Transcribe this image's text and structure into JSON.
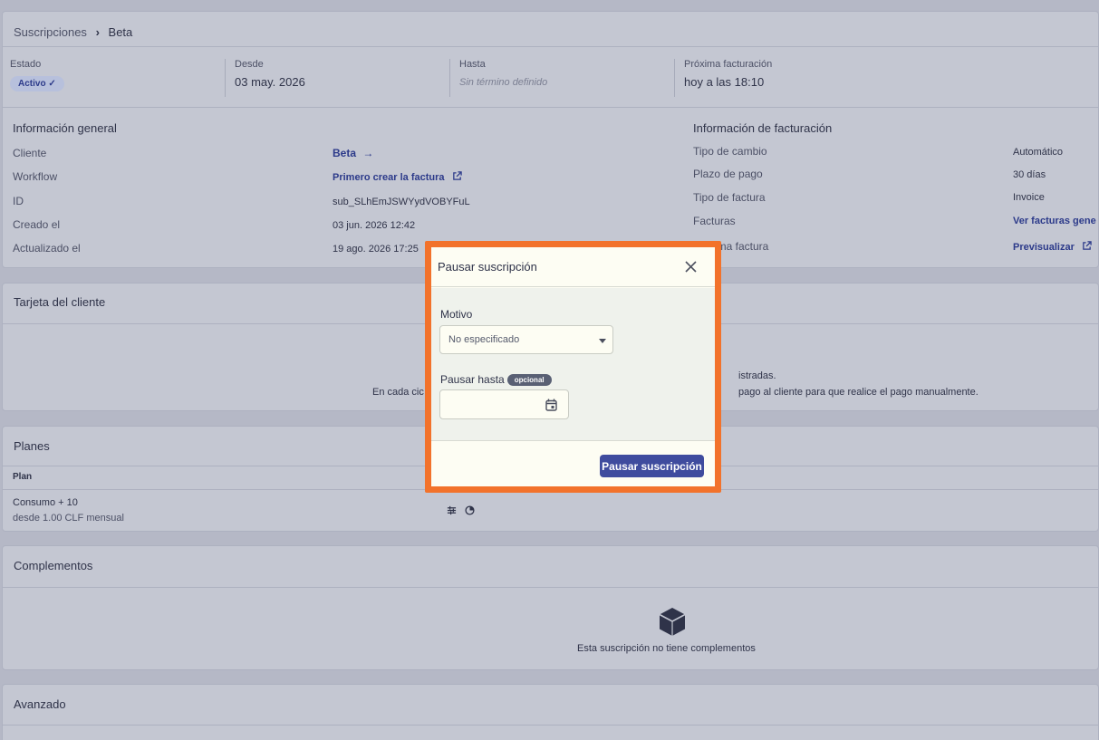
{
  "breadcrumb": {
    "root": "Suscripciones",
    "separator": "›",
    "current": "Beta"
  },
  "stats": {
    "estado": {
      "label": "Estado",
      "value": "Activo ✓"
    },
    "desde": {
      "label": "Desde",
      "value": "03 may. 2026"
    },
    "hasta": {
      "label": "Hasta",
      "value": "Sin término definido"
    },
    "proxima": {
      "label": "Próxima facturación",
      "value": "hoy a las 18:10"
    }
  },
  "general": {
    "title": "Información general",
    "rows": [
      {
        "label": "Cliente",
        "value": "Beta"
      },
      {
        "label": "Workflow",
        "value": "Primero crear la factura"
      },
      {
        "label": "ID",
        "value": "sub_SLhEmJSWYydVOBYFuL"
      },
      {
        "label": "Creado el",
        "value": "03 jun. 2026 12:42"
      },
      {
        "label": "Actualizado el",
        "value": "19 ago. 2026 17:25"
      }
    ]
  },
  "billing": {
    "title": "Información de facturación",
    "rows": [
      {
        "label": "Tipo de cambio",
        "value": "Automático"
      },
      {
        "label": "Plazo de pago",
        "value": "30 días"
      },
      {
        "label": "Tipo de factura",
        "value": "Invoice"
      },
      {
        "label": "Facturas",
        "value": "Ver facturas gene"
      },
      {
        "label": "xima factura",
        "value": "Previsualizar"
      }
    ]
  },
  "tarjeta": {
    "title": "Tarjeta del cliente",
    "line1_right": "istradas.",
    "line2_left": "En cada cic",
    "line2_right": "pago al cliente para que realice el pago manualmente."
  },
  "planes": {
    "title": "Planes",
    "col_plan": "Plan",
    "rows": [
      {
        "name": "Consumo + 10",
        "sub": "desde 1.00 CLF mensual"
      }
    ]
  },
  "complementos": {
    "title": "Complementos",
    "empty": "Esta suscripción no tiene complementos"
  },
  "avanzado": {
    "title": "Avanzado"
  },
  "modal": {
    "title": "Pausar suscripción",
    "motivo_label": "Motivo",
    "motivo_value": "No especificado",
    "pausar_hasta_label": "Pausar hasta",
    "opcional": "opcional",
    "date_value": "",
    "submit": "Pausar suscripción"
  },
  "colors": {
    "accent": "#3f4c9e",
    "highlight": "#f2722b",
    "link": "#2c3a8a"
  }
}
